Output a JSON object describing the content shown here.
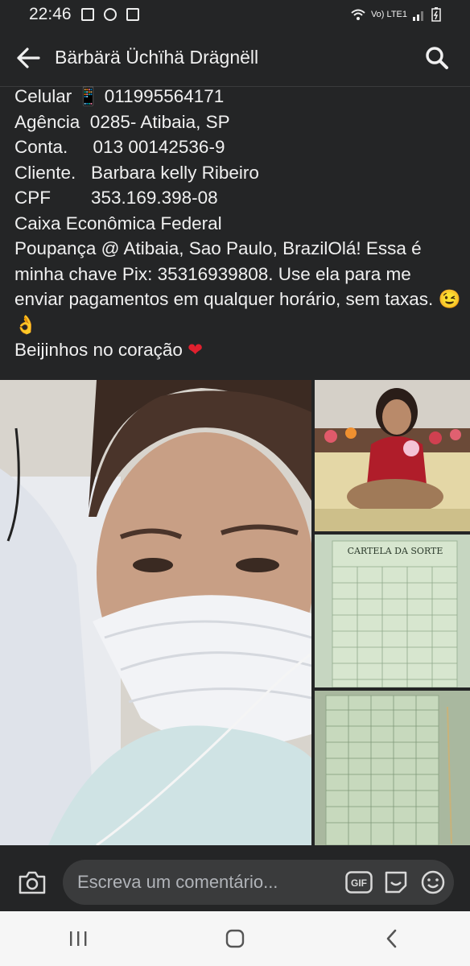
{
  "status": {
    "time": "22:46",
    "network": "Vo) LTE1"
  },
  "header": {
    "title": "Bärbärä Üchïhä Drägnëll"
  },
  "post": {
    "lines": [
      "Celular 📱 011995564171",
      "Agência  0285- Atibaia, SP",
      "Conta.     013 00142536-9",
      "Cliente.   Barbara kelly Ribeiro",
      "CPF        353.169.398-08",
      "Caixa Econômica Federal"
    ],
    "paragraph": "Poupança @ Atibaia, Sao Paulo, BrazilOlá! Essa é minha chave Pix: 35316939808. Use ela para me enviar pagamentos em qualquer horário, sem taxas. 😉👌",
    "closing_text": "Beijinhos no coração",
    "closing_emoji": "❤"
  },
  "gallery": {
    "card_title": "CARTELA DA SORTE"
  },
  "comment": {
    "placeholder": "Escreva um comentário..."
  },
  "icons": {
    "back": "arrow-left-icon",
    "search": "search-icon",
    "camera": "camera-icon",
    "gif": "gif-icon",
    "sticker": "sticker-icon",
    "emoji": "emoji-icon",
    "recents": "recents-icon",
    "home": "home-icon",
    "back_nav": "chevron-left-icon"
  },
  "colors": {
    "background": "#242526",
    "field": "#3a3b3c",
    "text": "#f0f0f0",
    "placeholder": "#b0b3b8",
    "heart": "#e0202e",
    "navbar": "#f6f6f6"
  }
}
